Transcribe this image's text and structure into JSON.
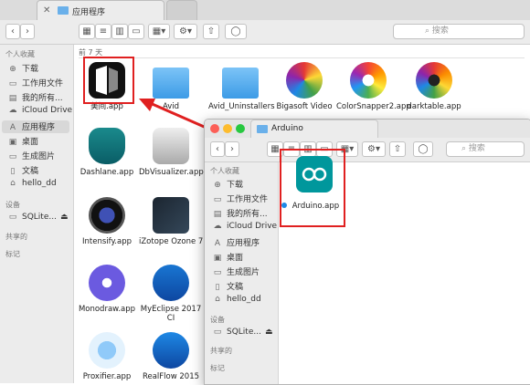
{
  "main_window": {
    "tab_title": "应用程序",
    "section_label": "前 7 天",
    "search_placeholder": "搜索",
    "sidebar": {
      "favorites_header": "个人收藏",
      "items": [
        {
          "label": "下载",
          "icon": "download-icon"
        },
        {
          "label": "工作用文件",
          "icon": "folder-icon"
        },
        {
          "label": "我的所有...",
          "icon": "all-files-icon"
        },
        {
          "label": "iCloud Drive",
          "icon": "cloud-icon"
        },
        {
          "label": "应用程序",
          "icon": "applications-icon"
        },
        {
          "label": "桌面",
          "icon": "desktop-icon"
        },
        {
          "label": "生成图片",
          "icon": "folder-icon"
        },
        {
          "label": "文稿",
          "icon": "document-icon"
        },
        {
          "label": "hello_dd",
          "icon": "home-icon"
        }
      ],
      "devices_header": "设备",
      "device_item": "SQLite...",
      "shared_header": "共享的",
      "tags_header": "标记"
    },
    "apps": [
      {
        "name": "美间.app",
        "icon": "meijian-app-icon"
      },
      {
        "name": "Avid",
        "icon": "folder-icon"
      },
      {
        "name": "Avid_Uninstallers",
        "icon": "folder-icon"
      },
      {
        "name": "Bigasoft Video",
        "icon": "bigasoft-app-icon"
      },
      {
        "name": "ColorSnapper2.app",
        "icon": "colorsnapper-app-icon"
      },
      {
        "name": "darktable.app",
        "icon": "darktable-app-icon"
      },
      {
        "name": "Dashlane.app",
        "icon": "dashlane-app-icon"
      },
      {
        "name": "DbVisualizer.app",
        "icon": "dbvisualizer-app-icon"
      },
      {
        "name": "Intensify.app",
        "icon": "intensify-app-icon"
      },
      {
        "name": "iZotope Ozone 7",
        "icon": "izotope-app-icon"
      },
      {
        "name": "Monodraw.app",
        "icon": "monodraw-app-icon"
      },
      {
        "name": "MyEclipse 2017 CI",
        "icon": "myeclipse-app-icon"
      },
      {
        "name": "Proxifier.app",
        "icon": "proxifier-app-icon"
      },
      {
        "name": "RealFlow 2015",
        "icon": "realflow-app-icon"
      }
    ]
  },
  "second_window": {
    "tab_title": "Arduino",
    "search_placeholder": "搜索",
    "sidebar": {
      "favorites_header": "个人收藏",
      "items": [
        {
          "label": "下载",
          "icon": "download-icon"
        },
        {
          "label": "工作用文件",
          "icon": "folder-icon"
        },
        {
          "label": "我的所有...",
          "icon": "all-files-icon"
        },
        {
          "label": "iCloud Drive",
          "icon": "cloud-icon"
        },
        {
          "label": "应用程序",
          "icon": "applications-icon"
        },
        {
          "label": "桌面",
          "icon": "desktop-icon"
        },
        {
          "label": "生成图片",
          "icon": "folder-icon"
        },
        {
          "label": "文稿",
          "icon": "document-icon"
        },
        {
          "label": "hello_dd",
          "icon": "home-icon"
        }
      ],
      "devices_header": "设备",
      "device_item": "SQLite...",
      "shared_header": "共享的",
      "tags_header": "标记"
    },
    "file": {
      "name": "Arduino.app",
      "icon": "arduino-app-icon"
    }
  },
  "colors": {
    "highlight_red": "#e02020",
    "accent_blue": "#1d8be8",
    "arduino_teal": "#00979c"
  }
}
